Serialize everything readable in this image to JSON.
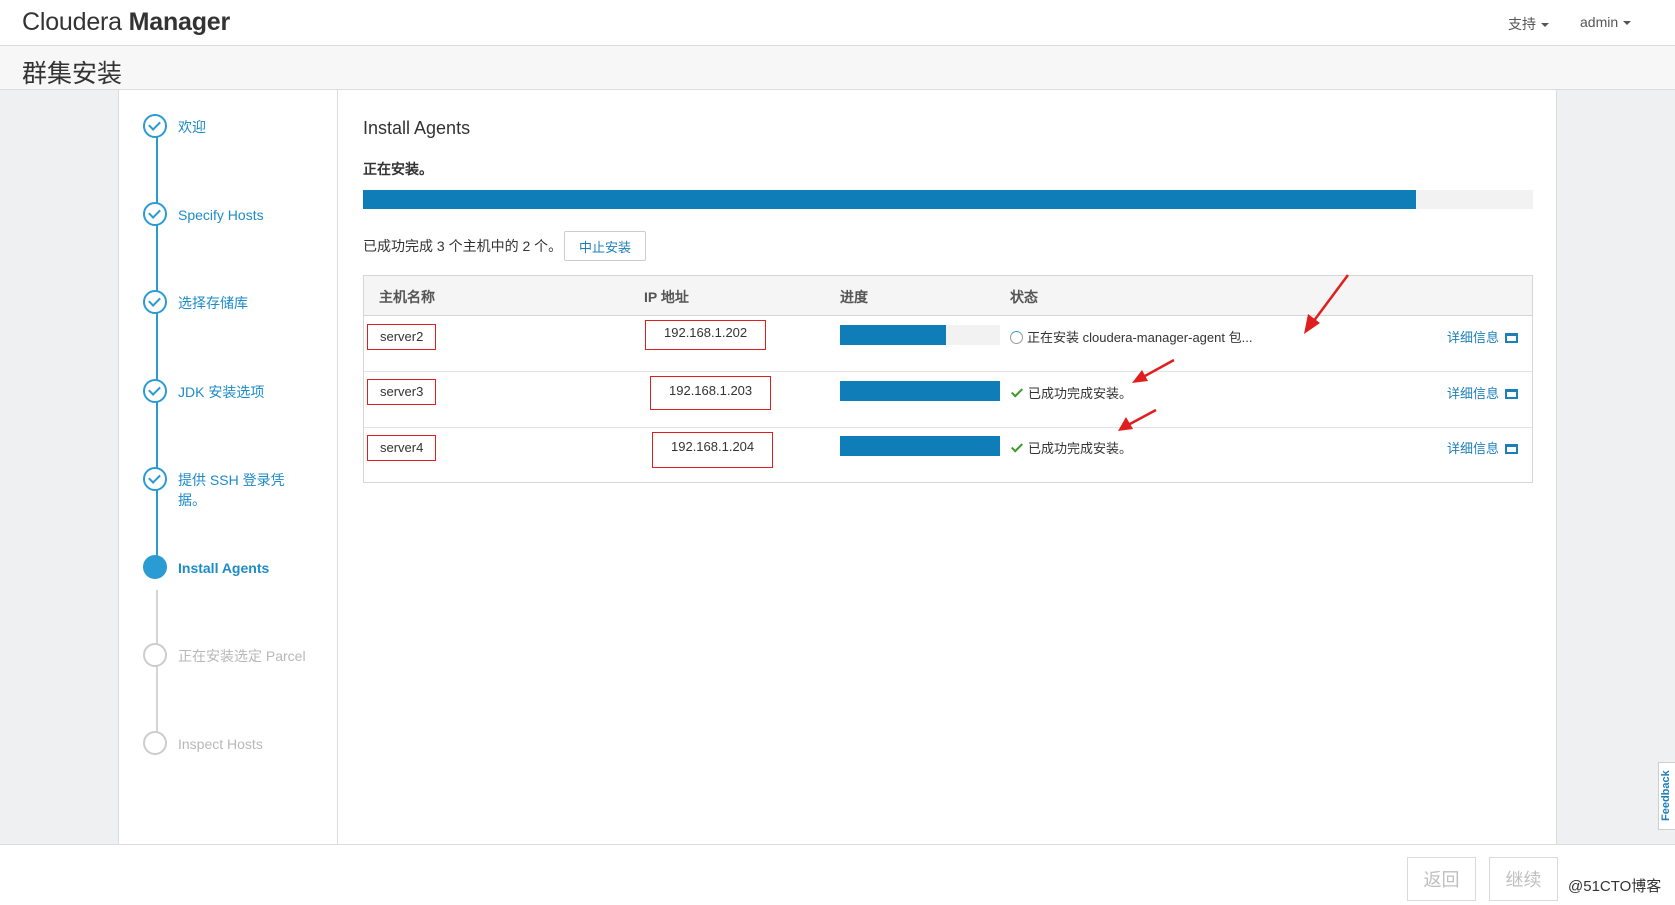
{
  "app": {
    "logo_light": "Cloudera ",
    "logo_bold": "Manager",
    "nav_support": "支持",
    "nav_user": "admin"
  },
  "page": {
    "title": "群集安装"
  },
  "wizard": {
    "steps": [
      {
        "label": "欢迎",
        "state": "done"
      },
      {
        "label": "Specify Hosts",
        "state": "done"
      },
      {
        "label": "选择存储库",
        "state": "done"
      },
      {
        "label": "JDK 安装选项",
        "state": "done"
      },
      {
        "label": "提供 SSH 登录凭据。",
        "state": "done"
      },
      {
        "label": "Install Agents",
        "state": "current"
      },
      {
        "label": "正在安装选定 Parcel",
        "state": "future"
      },
      {
        "label": "Inspect Hosts",
        "state": "future"
      }
    ]
  },
  "main": {
    "title": "Install Agents",
    "installing_label": "正在安装。",
    "overall_progress": 0.9,
    "summary": "已成功完成 3 个主机中的 2 个。",
    "abort_button": "中止安装",
    "table": {
      "headers": {
        "host": "主机名称",
        "ip": "IP 地址",
        "progress": "进度",
        "status": "状态"
      },
      "rows": [
        {
          "host": "server2",
          "ip": "192.168.1.202",
          "progress": 0.66,
          "status": "正在安装 cloudera-manager-agent 包...",
          "state": "installing",
          "details": "详细信息"
        },
        {
          "host": "server3",
          "ip": "192.168.1.203",
          "progress": 1.0,
          "status": "已成功完成安装。",
          "state": "success",
          "details": "详细信息"
        },
        {
          "host": "server4",
          "ip": "192.168.1.204",
          "progress": 1.0,
          "status": "已成功完成安装。",
          "state": "success",
          "details": "详细信息"
        }
      ]
    }
  },
  "footer": {
    "back_button": "返回",
    "continue_button": "继续",
    "watermark": "@51CTO博客"
  },
  "feedback_tab": "Feedback",
  "colors": {
    "brand_blue": "#0f7db7",
    "link_blue": "#1d8bc8",
    "success_green": "#3c9a2a",
    "annotation_red": "#e01e1e"
  }
}
